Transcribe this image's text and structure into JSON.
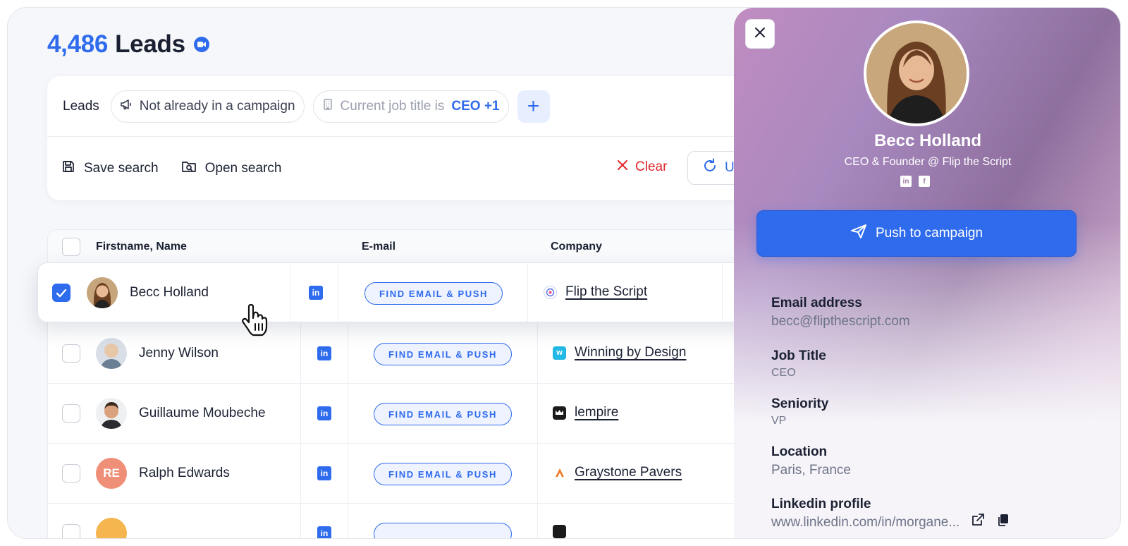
{
  "header": {
    "lead_count": "4,486",
    "title": "Leads"
  },
  "filters": {
    "label": "Leads",
    "chip1": "Not already in a campaign",
    "chip2_prefix": "Current job title is",
    "chip2_value": "CEO +1",
    "add": "+"
  },
  "actions": {
    "save": "Save search",
    "open": "Open search",
    "clear": "Clear",
    "update": "U"
  },
  "table": {
    "columns": [
      "Firstname, Name",
      "E-mail",
      "Company"
    ],
    "find_label": "FIND EMAIL & PUSH",
    "rows": [
      {
        "name": "Becc Holland",
        "company": "Flip the Script",
        "checked": true
      },
      {
        "name": "Jenny Wilson",
        "company": "Winning by Design",
        "checked": false
      },
      {
        "name": "Guillaume Moubeche",
        "company": "lempire",
        "checked": false
      },
      {
        "name": "Ralph Edwards",
        "initials": "RE",
        "company": "Graystone Pavers",
        "checked": false
      }
    ]
  },
  "panel": {
    "name": "Becc Holland",
    "role": "CEO & Founder @ Flip the Script",
    "push_label": "Push to campaign",
    "fields": [
      {
        "label": "Email address",
        "value": "becc@flipthescript.com"
      },
      {
        "label": "Job Title",
        "value": "CEO"
      },
      {
        "label": "Seniority",
        "value": "VP"
      },
      {
        "label": "Location",
        "value": "Paris, France"
      },
      {
        "label": "Linkedin profile",
        "value": "www.linkedin.com/in/morgane..."
      }
    ]
  },
  "colors": {
    "accent": "#2f6bed",
    "danger": "#e0262b",
    "text": "#1b2133",
    "muted": "#6e7488"
  },
  "icons": [
    "video-badge-icon",
    "megaphone-icon",
    "building-icon",
    "plus-icon",
    "save-icon",
    "open-search-icon",
    "close-icon",
    "refresh-icon",
    "linkedin-icon",
    "facebook-icon",
    "send-icon",
    "external-link-icon",
    "copy-icon",
    "hand-cursor-icon"
  ]
}
